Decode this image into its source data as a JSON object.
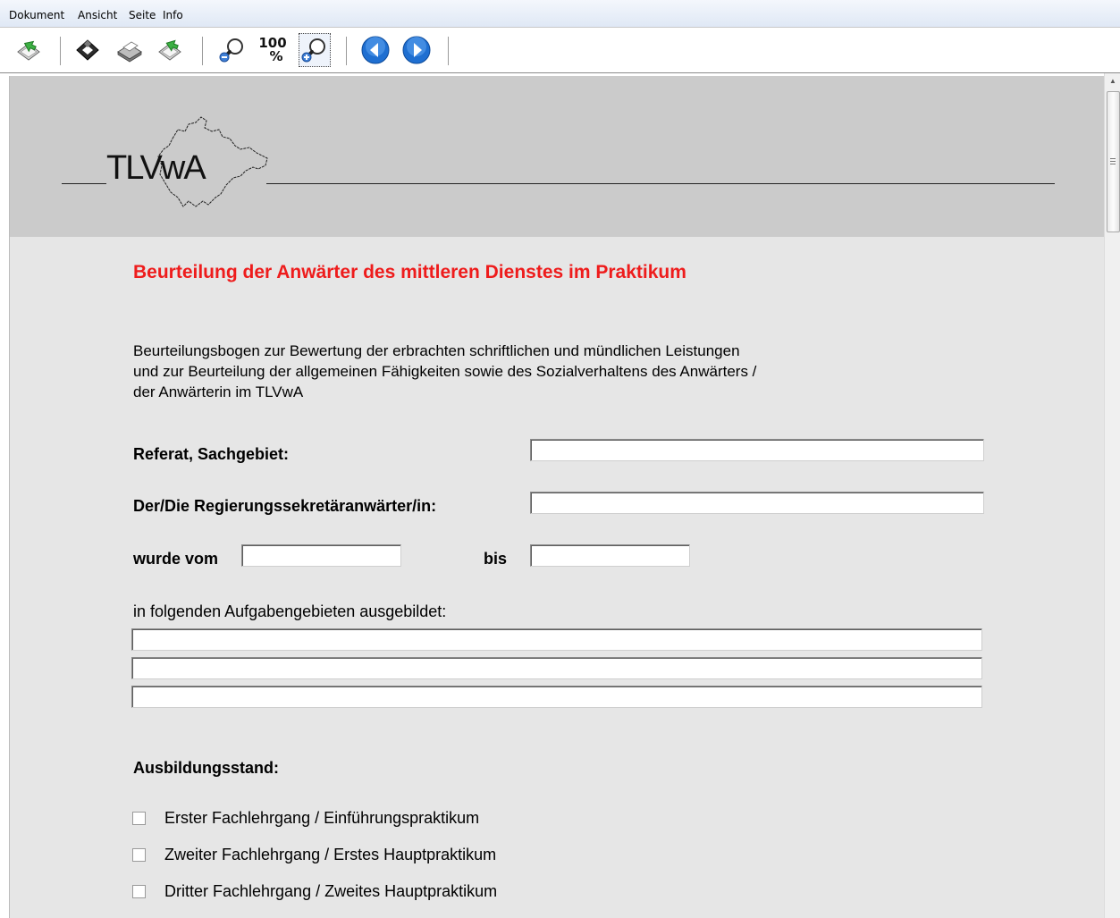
{
  "menu": {
    "items": [
      "Dokument",
      "Ansicht",
      "Seite",
      "Info"
    ]
  },
  "toolbar": {
    "zoom_100_label": "100\n%",
    "zoom_100_top": "100",
    "zoom_100_bottom": "%"
  },
  "document": {
    "logo_text": "TLVwA",
    "title": "Beurteilung der Anwärter des mittleren Dienstes im Praktikum",
    "intro_lines": [
      "Beurteilungsbogen zur Bewertung der erbrachten schriftlichen und mündlichen Leistungen",
      "und zur Beurteilung der allgemeinen Fähigkeiten sowie des Sozialverhaltens des Anwärters /",
      "der Anwärterin im  TLVwA"
    ],
    "fields": {
      "referat_label": "Referat, Sachgebiet:",
      "referat_value": "",
      "anwaerter_label": "Der/Die Regierungssekretäranwärter/in:",
      "anwaerter_value": "",
      "vom_label": "wurde vom",
      "vom_value": "",
      "bis_label": "bis",
      "bis_value": "",
      "aufgaben_label": "in folgenden Aufgabengebieten ausgebildet:",
      "aufgaben_values": [
        "",
        "",
        ""
      ]
    },
    "ausbildungsstand": {
      "label": "Ausbildungsstand:",
      "options": [
        {
          "label": "Erster Fachlehrgang / Einführungspraktikum",
          "checked": false
        },
        {
          "label": "Zweiter Fachlehrgang / Erstes Hauptpraktikum",
          "checked": false
        },
        {
          "label": "Dritter Fachlehrgang / Zweites Hauptpraktikum",
          "checked": false
        }
      ]
    }
  },
  "colors": {
    "title": "#ee1c1c",
    "page_background": "#e6e6e6",
    "banner": "#cbcbcb"
  }
}
